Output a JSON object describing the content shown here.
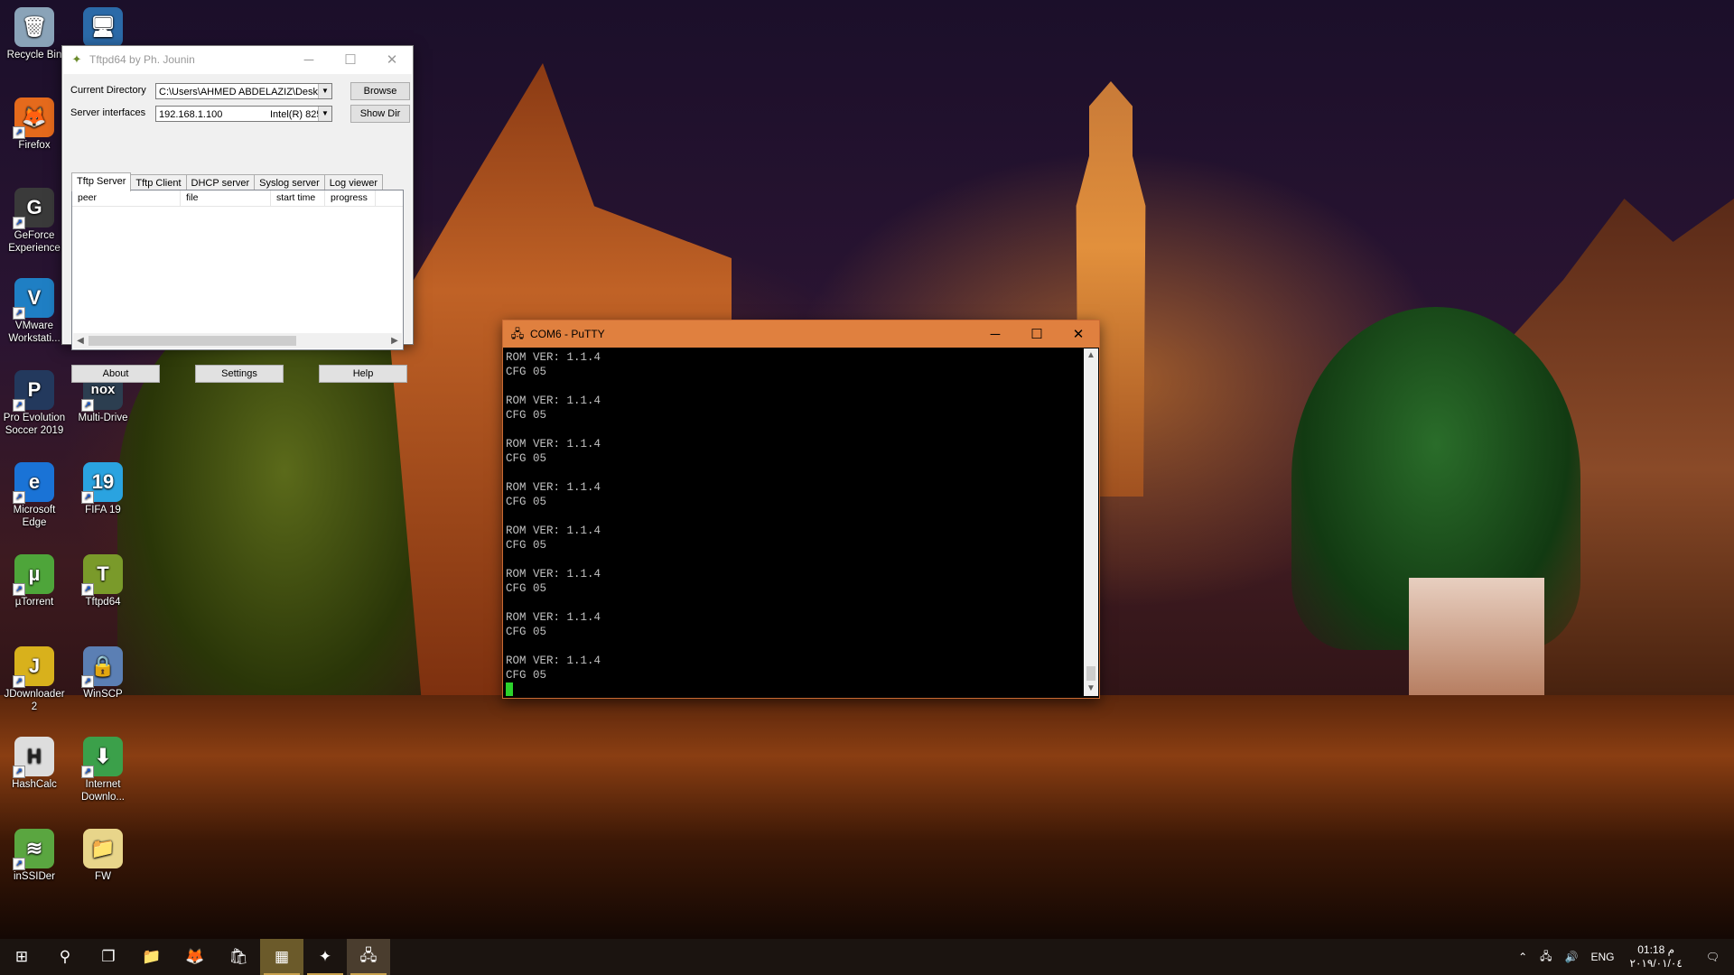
{
  "desktop": {
    "icons": [
      {
        "label": "Recycle Bin",
        "glyph": "🗑",
        "color": "#8aa3b8"
      },
      {
        "label": "",
        "glyph": "🖥",
        "color": "#2b6aa8"
      },
      {
        "label": "Firefox",
        "glyph": "🦊",
        "color": "#e56a1c"
      },
      {
        "label": "GeForce Experience",
        "glyph": "G",
        "color": "#3a3a3a"
      },
      {
        "label": "VMware Workstati...",
        "glyph": "V",
        "color": "#1f7fc4"
      },
      {
        "label": "Pro Evolution Soccer 2019",
        "glyph": "P",
        "color": "#23395d"
      },
      {
        "label": "Multi-Drive",
        "glyph": "nox",
        "color": "#2c3e50"
      },
      {
        "label": "Microsoft Edge",
        "glyph": "e",
        "color": "#1a73d6"
      },
      {
        "label": "FIFA 19",
        "glyph": "19",
        "color": "#2aa3e0"
      },
      {
        "label": "µTorrent",
        "glyph": "µ",
        "color": "#4ea53a"
      },
      {
        "label": "Tftpd64",
        "glyph": "T",
        "color": "#7a9a2a"
      },
      {
        "label": "JDownloader 2",
        "glyph": "J",
        "color": "#d8b11c"
      },
      {
        "label": "WinSCP",
        "glyph": "🔒",
        "color": "#5b7fb4"
      },
      {
        "label": "HashCalc",
        "glyph": "H",
        "color": "#dddddd"
      },
      {
        "label": "Internet Downlo...",
        "glyph": "⬇",
        "color": "#3ba04a"
      },
      {
        "label": "inSSIDer",
        "glyph": "≋",
        "color": "#5aa640"
      },
      {
        "label": "FW",
        "glyph": "📁",
        "color": "#e8d58a"
      }
    ]
  },
  "tftpd": {
    "title": "Tftpd64 by Ph. Jounin",
    "icon": "tftpd-icon",
    "current_directory_label": "Current Directory",
    "current_directory_value": "C:\\Users\\AHMED ABDELAZIZ\\Desk",
    "server_interfaces_label": "Server interfaces",
    "server_ip": "192.168.1.100",
    "server_adapter": "Intel(R) 825",
    "browse_label": "Browse",
    "show_dir_label": "Show Dir",
    "tabs": [
      "Tftp Server",
      "Tftp Client",
      "DHCP server",
      "Syslog server",
      "Log viewer"
    ],
    "active_tab": "Tftp Server",
    "columns": [
      "peer",
      "file",
      "start time",
      "progress"
    ],
    "about_label": "About",
    "settings_label": "Settings",
    "help_label": "Help"
  },
  "putty": {
    "title": "COM6 - PuTTY",
    "lines": [
      "ROM VER: 1.1.4",
      "CFG 05",
      "",
      "ROM VER: 1.1.4",
      "CFG 05",
      "",
      "ROM VER: 1.1.4",
      "CFG 05",
      "",
      "ROM VER: 1.1.4",
      "CFG 05",
      "",
      "ROM VER: 1.1.4",
      "CFG 05",
      "",
      "ROM VER: 1.1.4",
      "CFG 05",
      "",
      "ROM VER: 1.1.4",
      "CFG 05",
      "",
      "ROM VER: 1.1.4",
      "CFG 05"
    ],
    "title_color": "#e0803f"
  },
  "taskbar": {
    "language": "ENG",
    "time": "01:18 م",
    "date": "٢٠١٩/٠١/٠٤",
    "items": [
      {
        "name": "start-button",
        "glyph": "⊞"
      },
      {
        "name": "search-button",
        "glyph": "⚲"
      },
      {
        "name": "task-view-button",
        "glyph": "❐"
      },
      {
        "name": "file-explorer-button",
        "glyph": "📁"
      },
      {
        "name": "firefox-taskbar-button",
        "glyph": "🦊"
      },
      {
        "name": "store-taskbar-button",
        "glyph": "🛍"
      },
      {
        "name": "calculator-taskbar-button",
        "glyph": "▦"
      },
      {
        "name": "tftpd-taskbar-button",
        "glyph": "✦"
      },
      {
        "name": "putty-taskbar-button",
        "glyph": "🖧"
      }
    ]
  }
}
